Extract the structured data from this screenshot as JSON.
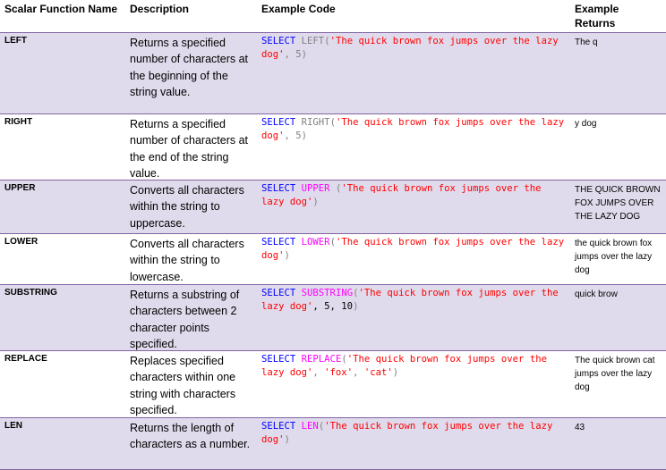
{
  "headers": {
    "name": "Scalar Function Name",
    "description": "Description",
    "code": "Example Code",
    "returns": "Example Returns"
  },
  "rows": [
    {
      "name": "LEFT",
      "description": "Returns a specified number of characters at the beginning of the string value.",
      "code": {
        "kw": "SELECT",
        "fn": "LEFT",
        "open": "(",
        "str": "'The quick brown fox jumps over the lazy dog'",
        "args": ", 5",
        "close": ")"
      },
      "returns": "The q"
    },
    {
      "name": "RIGHT",
      "description": "Returns a specified number of characters at the end of the string value.",
      "code": {
        "kw": "SELECT",
        "fn": "RIGHT",
        "open": "(",
        "str": "'The quick brown fox jumps over the lazy dog'",
        "args": ", 5",
        "close": ")"
      },
      "returns": "y dog"
    },
    {
      "name": "UPPER",
      "description": "Converts all characters within the string to uppercase.",
      "code": {
        "kw": "SELECT",
        "fn": "UPPER",
        "open": " (",
        "str": "'The quick brown fox jumps over the lazy dog'",
        "args": "",
        "close": ")"
      },
      "returns": "THE QUICK BROWN FOX JUMPS OVER THE LAZY DOG"
    },
    {
      "name": "LOWER",
      "description": "Converts all characters within the string to lowercase.",
      "code": {
        "kw": "SELECT",
        "fn": "LOWER",
        "open": "(",
        "str": "'The quick brown fox jumps over the lazy dog'",
        "args": "",
        "close": ")"
      },
      "returns": "the quick brown fox jumps over the lazy dog"
    },
    {
      "name": "SUBSTRING",
      "description": "Returns a substring of characters between 2 character points specified.",
      "code": {
        "kw": "SELECT",
        "fn": "SUBSTRING",
        "open": "(",
        "str": "'The quick brown fox jumps over the lazy dog'",
        "args": ", 5, 10",
        "close": ")"
      },
      "returns": "quick brow"
    },
    {
      "name": "REPLACE",
      "description": "Replaces specified characters within one string with characters specified.",
      "code": {
        "kw": "SELECT",
        "fn": "REPLACE",
        "open": "(",
        "str": "'The quick brown fox jumps over the lazy dog'",
        "args2": ", ",
        "str2": "'fox'",
        "args3": ", ",
        "str3": "'cat'",
        "close": ")"
      },
      "returns": "The quick brown cat jumps over the lazy dog"
    },
    {
      "name": "LEN",
      "description": "Returns the length of characters as a number.",
      "code": {
        "kw": "SELECT",
        "fn": "LEN",
        "open": "(",
        "str": "'The quick brown fox jumps over the lazy dog'",
        "args": "",
        "close": ")"
      },
      "returns": "43"
    }
  ]
}
